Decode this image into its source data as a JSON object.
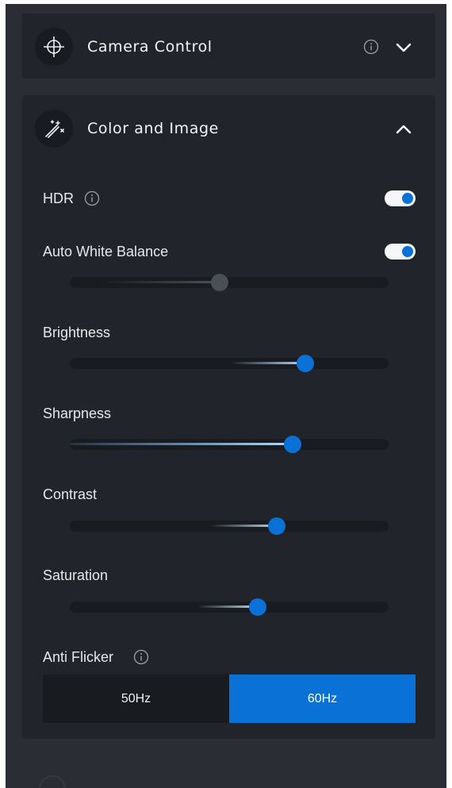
{
  "camera_control": {
    "title": "Camera Control",
    "icon": "crosshair-icon",
    "expanded": false
  },
  "color_image": {
    "title": "Color and Image",
    "icon": "magic-wand-icon",
    "expanded": true,
    "hdr": {
      "label": "HDR",
      "on": true
    },
    "auto_white_balance": {
      "label": "Auto White Balance",
      "on": true,
      "slider_level": 0.47,
      "slider_disabled": true
    },
    "brightness": {
      "label": "Brightness",
      "level": 0.74
    },
    "sharpness": {
      "label": "Sharpness",
      "level": 0.7
    },
    "contrast": {
      "label": "Contrast",
      "level": 0.65
    },
    "saturation": {
      "label": "Saturation",
      "level": 0.59
    },
    "anti_flicker": {
      "label": "Anti Flicker",
      "options": [
        "50Hz",
        "60Hz"
      ],
      "selected": "60Hz"
    }
  },
  "colors": {
    "accent": "#0a72d6",
    "panel": "#2a2e34",
    "card": "#21252b",
    "track": "#181b20"
  }
}
